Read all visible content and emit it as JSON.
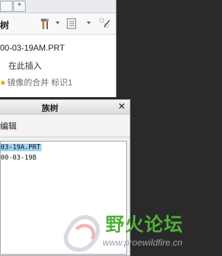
{
  "model_tree": {
    "tabs": [
      "*"
    ],
    "title_fragment": "树",
    "icons": [
      "hammer-settings-icon",
      "tree-filter-icon",
      "show-columns-icon"
    ],
    "items": [
      {
        "label": "00-03-19AM.PRT"
      },
      {
        "label": "在此插入"
      },
      {
        "label": "镜像的合并 标识1"
      }
    ]
  },
  "dialog": {
    "title": "族树",
    "close_label": "×",
    "menu_edit": "编辑",
    "list_items": [
      {
        "label": "03-19A.PRT",
        "selected": true
      },
      {
        "label": "00-03-19B",
        "selected": false
      }
    ]
  },
  "watermark": {
    "text_cn": "野火论坛",
    "url": "www.proewildfire.cn"
  },
  "colors": {
    "background": "#2a2a2a",
    "selection": "#9fd3f3",
    "watermark_green": "#4fb13a"
  }
}
